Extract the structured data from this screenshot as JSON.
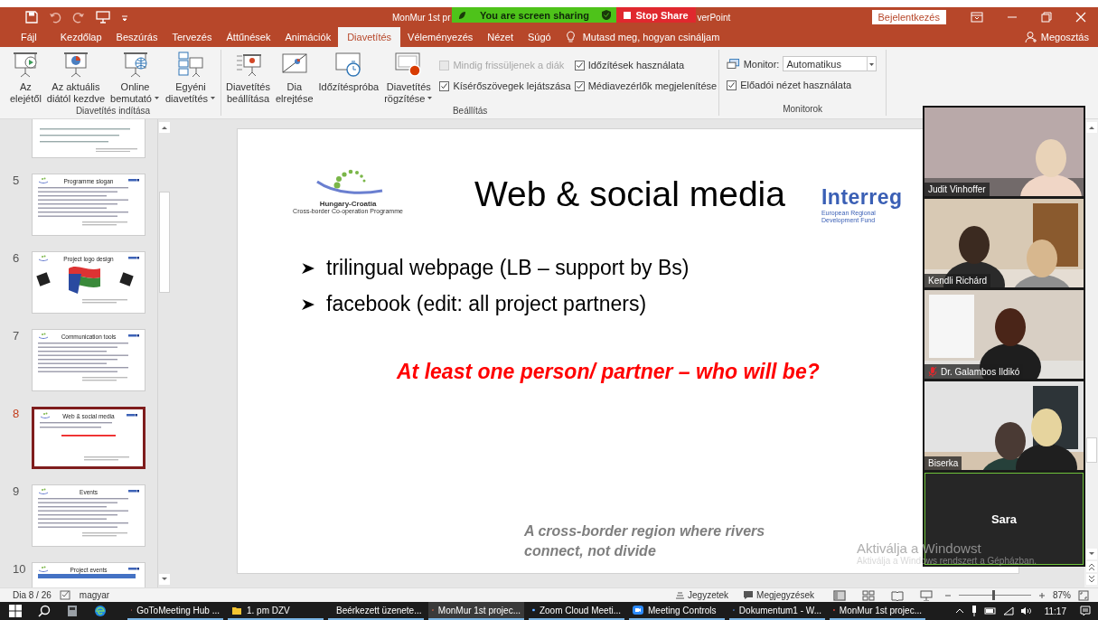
{
  "title_bar": {
    "title_start": "MonMur 1st pr",
    "title_end": "verPoint",
    "sharing": {
      "status": "You are screen sharing",
      "stop_button": "Stop Share"
    },
    "sign_in": "Bejelentkezés"
  },
  "tabs": [
    {
      "label": "Fájl",
      "selected": false
    },
    {
      "label": "Kezdőlap",
      "selected": false
    },
    {
      "label": "Beszúrás",
      "selected": false
    },
    {
      "label": "Tervezés",
      "selected": false
    },
    {
      "label": "Áttűnések",
      "selected": false
    },
    {
      "label": "Animációk",
      "selected": false
    },
    {
      "label": "Diavetítés",
      "selected": true
    },
    {
      "label": "Véleményezés",
      "selected": false
    },
    {
      "label": "Nézet",
      "selected": false
    },
    {
      "label": "Súgó",
      "selected": false
    }
  ],
  "tell_me": "Mutasd meg, hogyan csináljam",
  "share": "Megosztás",
  "ribbon": [
    {
      "label": "Diavetítés indítása",
      "items": [
        {
          "kind": "big",
          "lines": [
            "Az",
            "elejétől"
          ],
          "dropdown": false
        },
        {
          "kind": "big",
          "lines": [
            "Az aktuális",
            "diától kezdve"
          ],
          "dropdown": false
        },
        {
          "kind": "big",
          "lines": [
            "Online",
            "bemutató"
          ],
          "dropdown": true
        },
        {
          "kind": "big",
          "lines": [
            "Egyéni",
            "diavetítés"
          ],
          "dropdown": true
        }
      ]
    },
    {
      "label": "Beállítás",
      "items": [
        {
          "kind": "big",
          "lines": [
            "Diavetítés",
            "beállítása"
          ],
          "dropdown": false
        },
        {
          "kind": "big",
          "lines": [
            "Dia",
            "elrejtése"
          ],
          "dropdown": false
        },
        {
          "kind": "big",
          "lines": [
            "Időzítéspróba"
          ],
          "dropdown": false
        },
        {
          "kind": "big",
          "lines": [
            "Diavetítés",
            "rögzítése"
          ],
          "dropdown": true
        },
        {
          "kind": "checks",
          "options": [
            {
              "label": "Mindig frissüljenek a diák",
              "checked": false,
              "disabled": true
            },
            {
              "label": "Kísérőszövegek lejátszása",
              "checked": true,
              "disabled": false
            }
          ]
        },
        {
          "kind": "checks",
          "options": [
            {
              "label": "Időzítések használata",
              "checked": true,
              "disabled": false
            },
            {
              "label": "Médiavezérlők megjelenítése",
              "checked": true,
              "disabled": false
            }
          ]
        }
      ]
    },
    {
      "label": "Monitorok",
      "items": [
        {
          "kind": "monitor",
          "label": "Monitor:",
          "value": "Automatikus",
          "options": [
            {
              "label": "Előadói nézet használata",
              "checked": true,
              "disabled": false
            }
          ]
        }
      ]
    }
  ],
  "slides": [
    {
      "kind": "partial",
      "selected": false
    },
    {
      "kind": "text",
      "number": "5",
      "title": "Programme slogan",
      "selected": false
    },
    {
      "kind": "logos",
      "number": "6",
      "title": "Project logo design",
      "selected": false
    },
    {
      "kind": "text",
      "number": "7",
      "title": "Communication tools",
      "selected": false
    },
    {
      "kind": "short",
      "number": "8",
      "title": "Web & social media",
      "selected": true
    },
    {
      "kind": "text",
      "number": "9",
      "title": "Events",
      "selected": false
    },
    {
      "kind": "table",
      "number": "10",
      "title": "Project events",
      "selected": false
    }
  ],
  "slide": {
    "programme_logo": {
      "name": "Hungary-Croatia",
      "subtitle": "Cross-border Co-operation Programme"
    },
    "title": "Web & social media",
    "interreg": {
      "name": "Interreg",
      "subtitle": "European Regional Development Fund"
    },
    "bullets": [
      "trilingual webpage (LB – support by Bs)",
      "facebook (edit: all project partners)"
    ],
    "callout": "At least one person/ partner – who will be?",
    "footer": "A cross-border region where rivers connect, not divide"
  },
  "participants": [
    {
      "name": "Judit Vinhoffer",
      "video": true,
      "muted": false,
      "speaking": false
    },
    {
      "name": "Kendli Richárd",
      "video": true,
      "muted": false,
      "speaking": false
    },
    {
      "name": "Dr. Galambos Ildikó",
      "video": true,
      "muted": true,
      "speaking": false
    },
    {
      "name": "Biserka",
      "video": true,
      "muted": false,
      "speaking": false
    },
    {
      "name": "Sara",
      "video": false,
      "speaking": true
    }
  ],
  "activation": [
    "Aktiválja a Windowst",
    "Aktiválja a Windows rendszert a Gépházban."
  ],
  "status_bar": {
    "slide_info": "Dia 8 / 26",
    "language": "magyar",
    "notes": "Jegyzetek",
    "comments": "Megjegyzések",
    "views": [
      {
        "selected": true
      },
      {
        "selected": false
      },
      {
        "selected": false
      },
      {
        "selected": false
      }
    ],
    "zoom": {
      "level": 0.47,
      "reading": "87%"
    }
  },
  "taskbar": {
    "apps": [
      {
        "label": "GoToMeeting Hub ...",
        "active": false
      },
      {
        "label": "1. pm DZV",
        "active": false
      },
      {
        "label": "Beérkezett üzenete...",
        "active": false
      },
      {
        "label": "MonMur 1st projec...",
        "active": true
      },
      {
        "label": "Zoom Cloud Meeti...",
        "active": false
      },
      {
        "label": "Meeting Controls",
        "active": false
      },
      {
        "label": "Dokumentum1 - W...",
        "active": false
      },
      {
        "label": "MonMur 1st projec...",
        "active": false
      }
    ],
    "clock": "11:17"
  }
}
